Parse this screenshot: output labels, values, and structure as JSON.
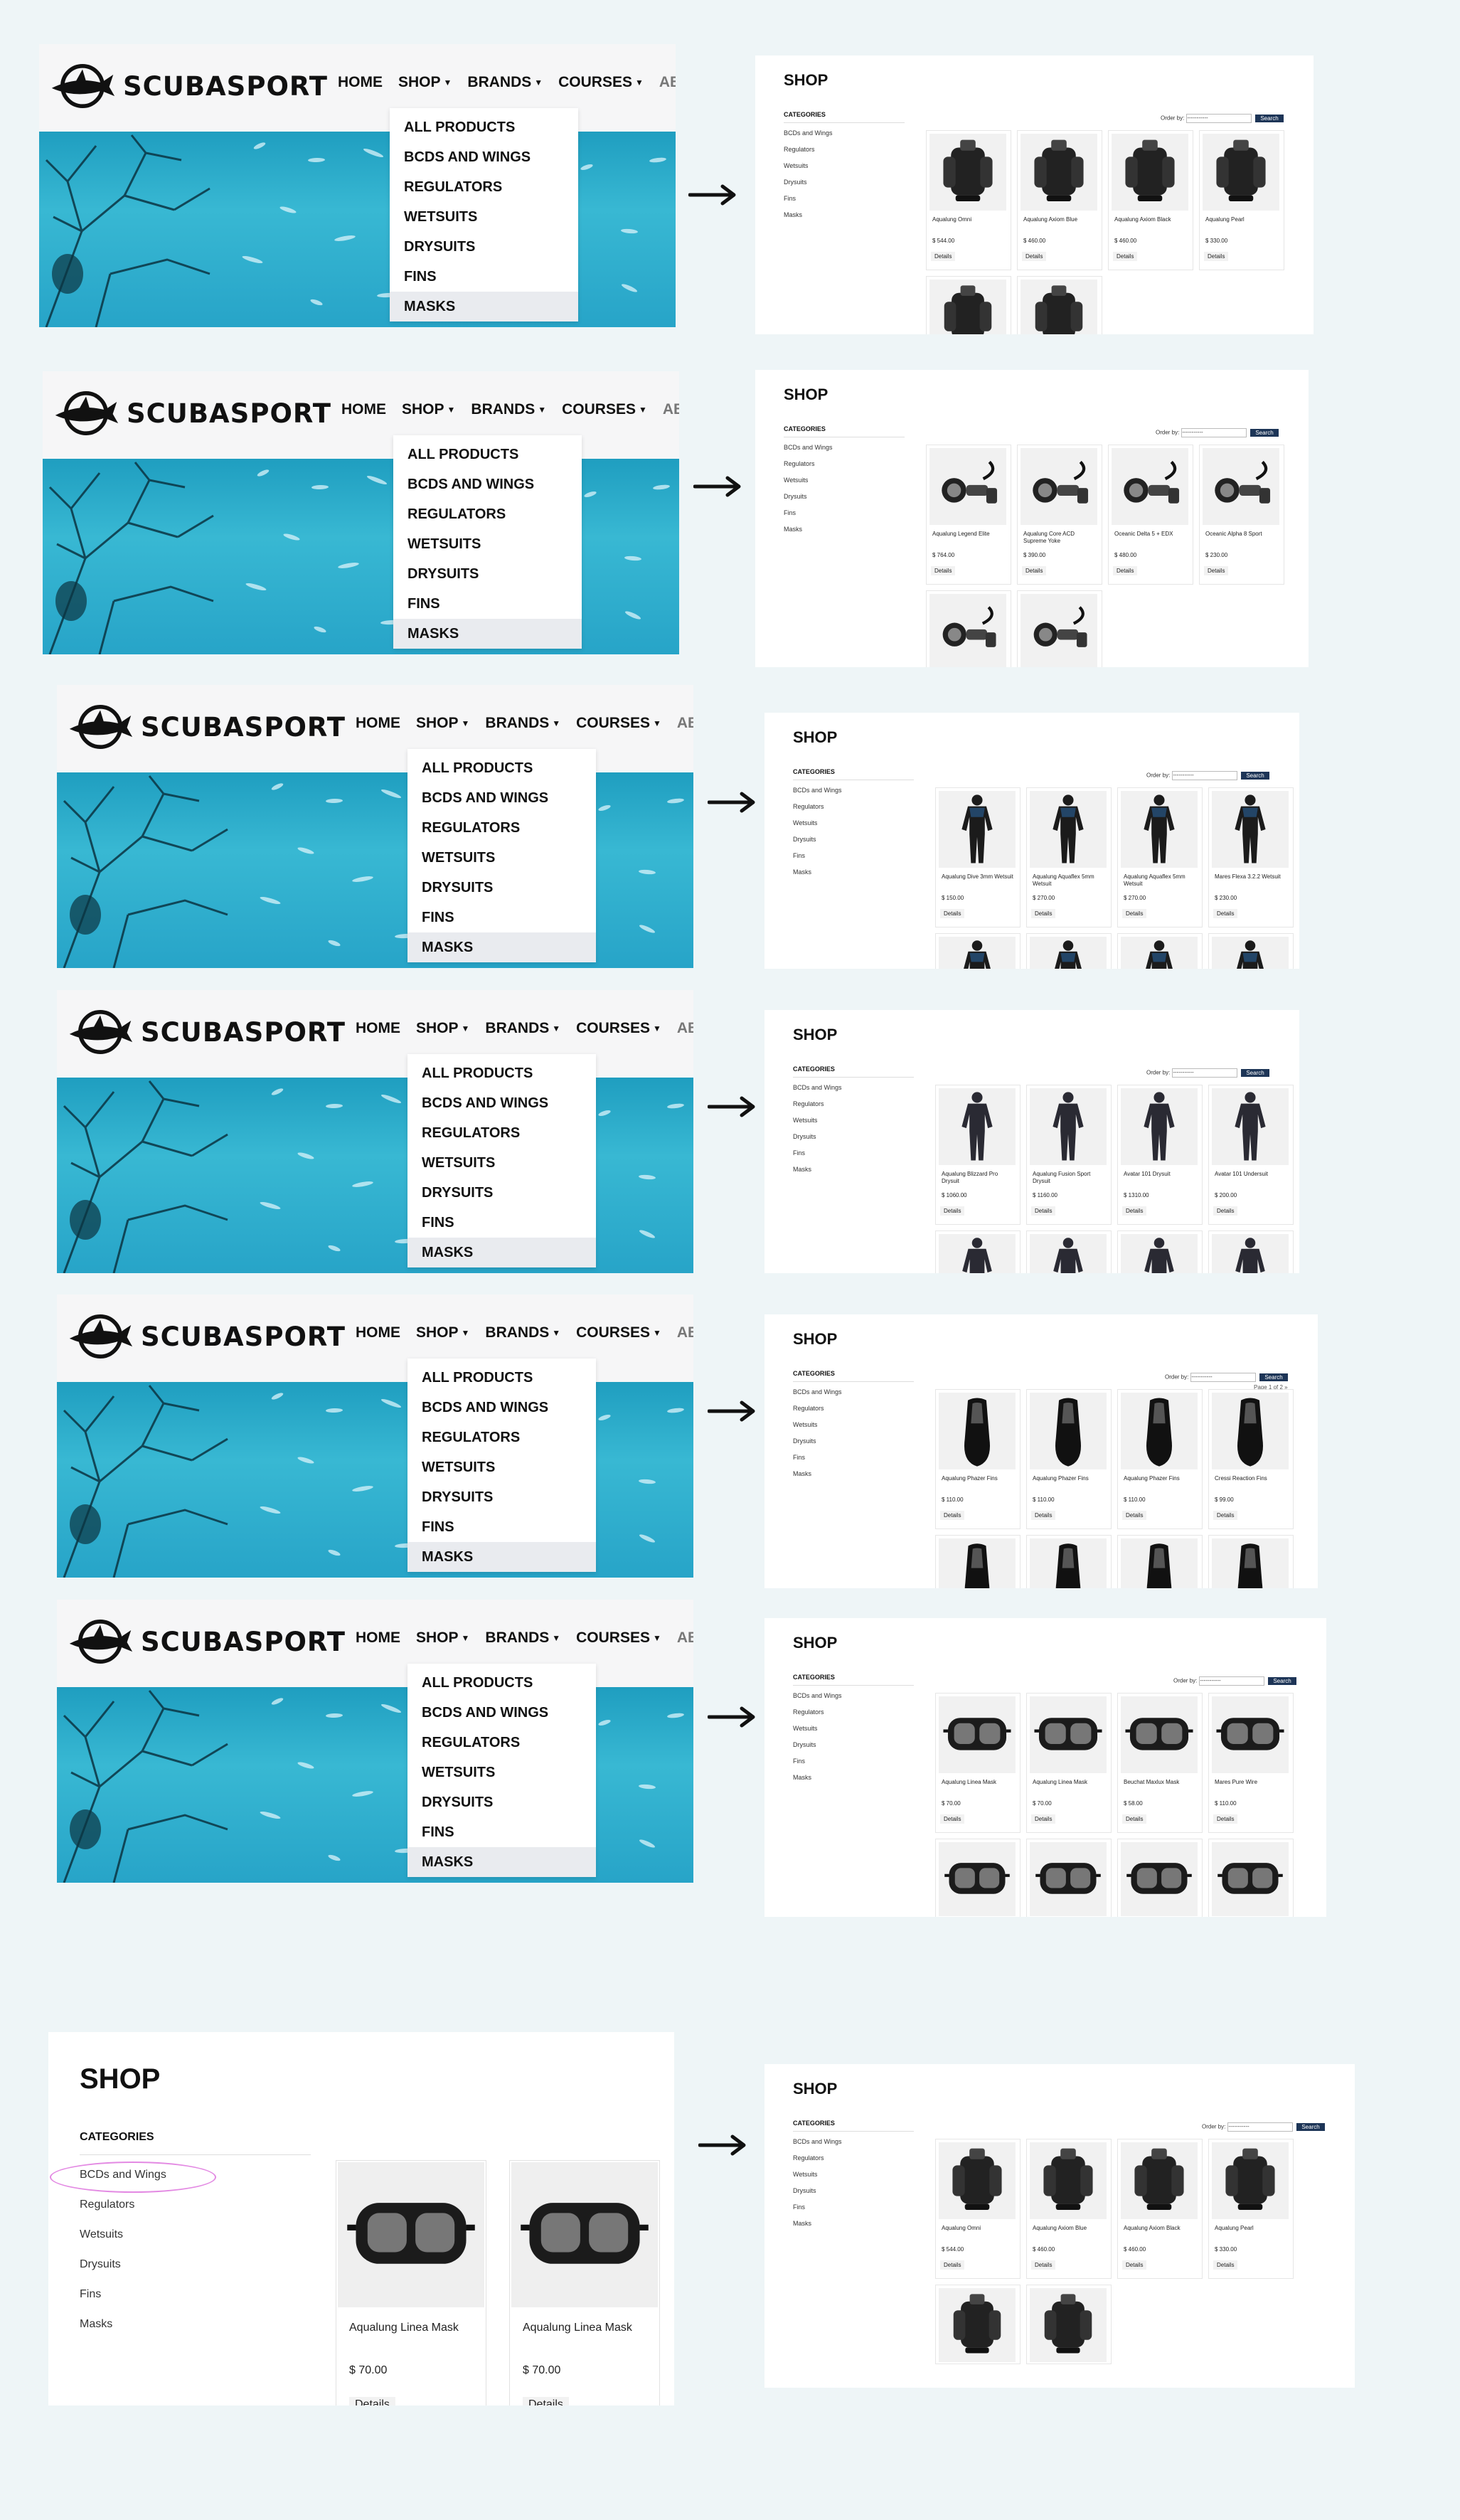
{
  "brand": "SCUBASPORT",
  "nav": {
    "home": "HOME",
    "shop": "SHOP",
    "brands": "BRANDS",
    "courses": "COURSES",
    "about": "ABOU"
  },
  "menu": [
    "ALL PRODUCTS",
    "BCDS AND WINGS",
    "REGULATORS",
    "WETSUITS",
    "DRYSUITS",
    "FINS",
    "MASKS"
  ],
  "colors": {
    "highlight": "#e38ae3",
    "search_button": "#1d3557",
    "ocean": "#2aa8c9",
    "page_bg": "#eef5f7"
  },
  "shop": {
    "title": "SHOP",
    "categories_heading": "CATEGORIES",
    "categories": [
      "BCDs and Wings",
      "Regulators",
      "Wetsuits",
      "Drysuits",
      "Fins",
      "Masks"
    ],
    "order_by": "Order by:",
    "order_select": "-----------",
    "search": "Search",
    "details": "Details",
    "page_info": "Page 1 of 2 »"
  },
  "rows": [
    {
      "highlighted": "BCDS AND WINGS",
      "products": [
        {
          "name": "Aqualung Omni",
          "price": "$ 544.00",
          "icon": "bcd"
        },
        {
          "name": "Aqualung Axiom Blue",
          "price": "$ 460.00",
          "icon": "bcd"
        },
        {
          "name": "Aqualung Axiom Black",
          "price": "$ 460.00",
          "icon": "bcd"
        },
        {
          "name": "Aqualung Pearl",
          "price": "$ 330.00",
          "icon": "bcd"
        }
      ]
    },
    {
      "highlighted": "REGULATORS",
      "products": [
        {
          "name": "Aqualung Legend Elite",
          "price": "$ 764.00",
          "icon": "regulator"
        },
        {
          "name": "Aqualung Core ACD Supreme Yoke",
          "price": "$ 390.00",
          "icon": "regulator"
        },
        {
          "name": "Oceanic Delta 5 + EDX",
          "price": "$ 480.00",
          "icon": "regulator"
        },
        {
          "name": "Oceanic Alpha 8 Sport",
          "price": "$ 230.00",
          "icon": "regulator"
        }
      ]
    },
    {
      "highlighted": "WETSUITS",
      "products": [
        {
          "name": "Aqualung Dive 3mm Wetsuit",
          "price": "$ 150.00",
          "icon": "wetsuit"
        },
        {
          "name": "Aqualung Aquaflex 5mm Wetsuit",
          "price": "$ 270.00",
          "icon": "wetsuit"
        },
        {
          "name": "Aqualung Aquaflex 5mm Wetsuit",
          "price": "$ 270.00",
          "icon": "wetsuit"
        },
        {
          "name": "Mares Flexa 3.2.2 Wetsuit",
          "price": "$ 230.00",
          "icon": "wetsuit"
        }
      ]
    },
    {
      "highlighted": "DRYSUITS",
      "products": [
        {
          "name": "Aqualung Blizzard Pro Drysuit",
          "price": "$ 1060.00",
          "icon": "drysuit"
        },
        {
          "name": "Aqualung Fusion Sport Drysuit",
          "price": "$ 1160.00",
          "icon": "drysuit"
        },
        {
          "name": "Avatar 101 Drysuit",
          "price": "$ 1310.00",
          "icon": "drysuit"
        },
        {
          "name": "Avatar 101 Undersuit",
          "price": "$ 200.00",
          "icon": "drysuit"
        }
      ]
    },
    {
      "highlighted": "FINS",
      "products": [
        {
          "name": "Aqualung Phazer Fins",
          "price": "$ 110.00",
          "icon": "fin"
        },
        {
          "name": "Aqualung Phazer Fins",
          "price": "$ 110.00",
          "icon": "fin"
        },
        {
          "name": "Aqualung Phazer Fins",
          "price": "$ 110.00",
          "icon": "fin"
        },
        {
          "name": "Cressi Reaction Fins",
          "price": "$ 99.00",
          "icon": "fin"
        }
      ]
    },
    {
      "highlighted": "MASKS",
      "products": [
        {
          "name": "Aqualung Linea Mask",
          "price": "$ 70.00",
          "icon": "mask"
        },
        {
          "name": "Aqualung Linea Mask",
          "price": "$ 70.00",
          "icon": "mask"
        },
        {
          "name": "Beuchat Maxlux Mask",
          "price": "$ 58.00",
          "icon": "mask"
        },
        {
          "name": "Mares Pure Wire",
          "price": "$ 110.00",
          "icon": "mask"
        }
      ]
    }
  ],
  "zoom": {
    "highlighted": "BCDs and Wings",
    "products": [
      {
        "name": "Aqualung Linea Mask",
        "price": "$ 70.00",
        "icon": "mask"
      },
      {
        "name": "Aqualung Linea Mask",
        "price": "$ 70.00",
        "icon": "mask"
      }
    ]
  },
  "result": {
    "products": [
      {
        "name": "Aqualung Omni",
        "price": "$ 544.00",
        "icon": "bcd"
      },
      {
        "name": "Aqualung Axiom Blue",
        "price": "$ 460.00",
        "icon": "bcd"
      },
      {
        "name": "Aqualung Axiom Black",
        "price": "$ 460.00",
        "icon": "bcd"
      },
      {
        "name": "Aqualung Pearl",
        "price": "$ 330.00",
        "icon": "bcd"
      }
    ]
  }
}
